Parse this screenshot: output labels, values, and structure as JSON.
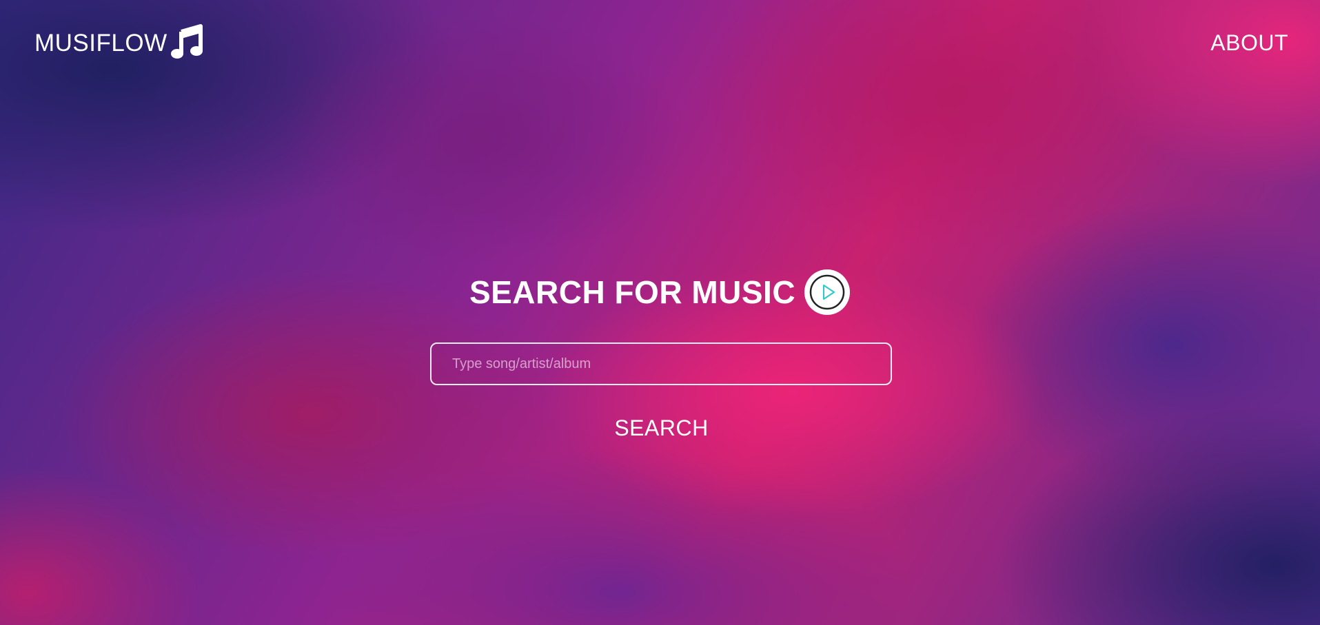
{
  "header": {
    "brand_name": "MUSIFLOW",
    "brand_icon": "music-note-icon",
    "about_label": "ABOUT"
  },
  "hero": {
    "title": "SEARCH FOR MUSIC",
    "title_icon": "play-circle-icon"
  },
  "search": {
    "value": "",
    "placeholder": "Type song/artist/album",
    "button_label": "SEARCH"
  },
  "colors": {
    "text": "#ffffff",
    "play_icon_accent": "#2cc9c9",
    "background_dark": "#22205f",
    "background_pink": "#e9267b",
    "background_purple": "#8e2490"
  }
}
